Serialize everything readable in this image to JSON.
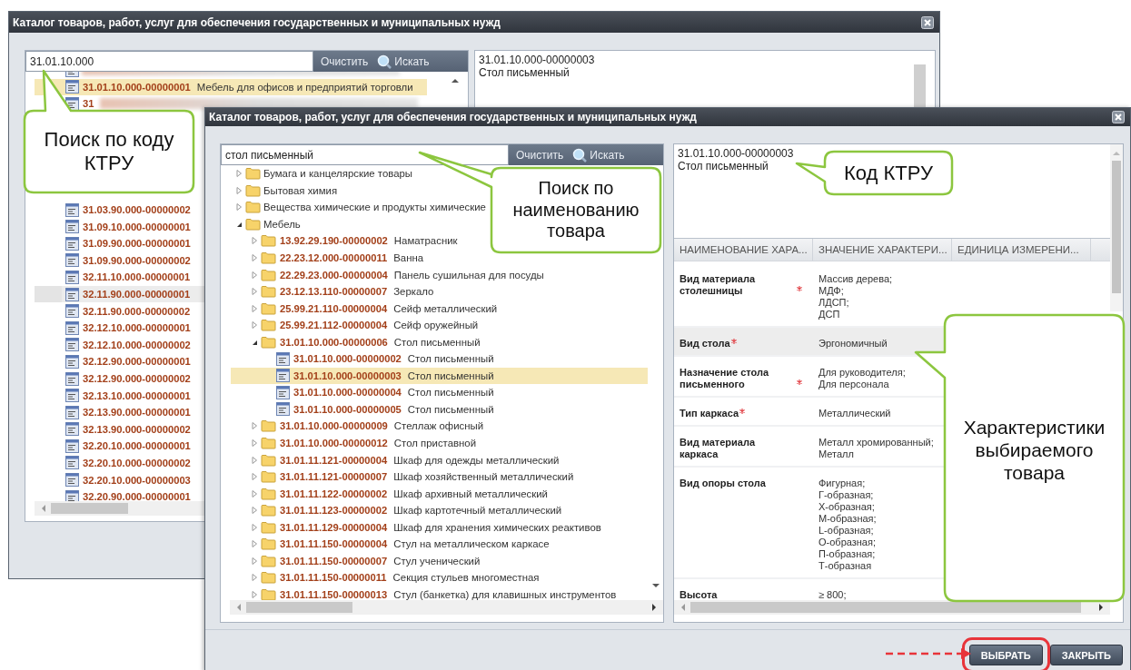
{
  "back_window": {
    "title": "Каталог товаров, работ, услуг для обеспечения государственных и муниципальных нужд",
    "search": {
      "value": "31.01.10.000",
      "clear_button": "Очистить",
      "search_button": "Искать"
    },
    "rows": [
      {
        "redacted": true,
        "selected": false,
        "hovered": false
      },
      {
        "code": "31.01.10.000-00000001",
        "name": "Мебель для офисов и предприятий торговли",
        "selected": true,
        "hovered": false
      },
      {
        "code": "31",
        "redacted": true,
        "selected": false,
        "hovered": false
      },
      {
        "code": "31.03.90.000-00000002",
        "selected": false,
        "hovered": false
      },
      {
        "code": "31.09.10.000-00000001",
        "selected": false,
        "hovered": false
      },
      {
        "code": "31.09.90.000-00000001",
        "selected": false,
        "hovered": false
      },
      {
        "code": "31.09.90.000-00000002",
        "selected": false,
        "hovered": false
      },
      {
        "code": "32.11.10.000-00000001",
        "selected": false,
        "hovered": false
      },
      {
        "code": "32.11.90.000-00000001",
        "selected": false,
        "hovered": true
      },
      {
        "code": "32.11.90.000-00000002",
        "selected": false,
        "hovered": false
      },
      {
        "code": "32.12.10.000-00000001",
        "selected": false,
        "hovered": false
      },
      {
        "code": "32.12.10.000-00000002",
        "selected": false,
        "hovered": false
      },
      {
        "code": "32.12.90.000-00000001",
        "selected": false,
        "hovered": false
      },
      {
        "code": "32.12.90.000-00000002",
        "selected": false,
        "hovered": false
      },
      {
        "code": "32.13.10.000-00000001",
        "selected": false,
        "hovered": false
      },
      {
        "code": "32.13.90.000-00000001",
        "selected": false,
        "hovered": false
      },
      {
        "code": "32.13.90.000-00000002",
        "selected": false,
        "hovered": false
      },
      {
        "code": "32.20.10.000-00000001",
        "selected": false,
        "hovered": false
      },
      {
        "code": "32.20.10.000-00000002",
        "selected": false,
        "hovered": false
      },
      {
        "code": "32.20.10.000-00000003",
        "selected": false,
        "hovered": false
      },
      {
        "code": "32.20.90.000-00000001",
        "selected": false,
        "hovered": false
      }
    ],
    "details": {
      "code": "31.01.10.000-00000003",
      "name": "Стол письменный"
    }
  },
  "front_window": {
    "title": "Каталог товаров, работ, услуг для обеспечения государственных и муниципальных нужд",
    "search": {
      "value": "стол письменный",
      "clear_button": "Очистить",
      "search_button": "Искать"
    },
    "tree": [
      {
        "kind": "folder",
        "name": "Бумага и канцелярские товары",
        "expanded": false,
        "selected": false
      },
      {
        "kind": "folder",
        "name": "Бытовая химия",
        "expanded": false,
        "selected": false
      },
      {
        "kind": "folder",
        "name": "Вещества химические и продукты химические",
        "expanded": false,
        "selected": false
      },
      {
        "kind": "folder",
        "name": "Мебель",
        "expanded": true,
        "selected": false,
        "children": [
          {
            "kind": "folder",
            "code": "13.92.29.190-00000002",
            "name": "Наматрасник",
            "expanded": false,
            "selected": false
          },
          {
            "kind": "folder",
            "code": "22.23.12.000-00000011",
            "name": "Ванна",
            "expanded": false,
            "selected": false
          },
          {
            "kind": "folder",
            "code": "22.29.23.000-00000004",
            "name": "Панель сушильная для посуды",
            "expanded": false,
            "selected": false
          },
          {
            "kind": "folder",
            "code": "23.12.13.110-00000007",
            "name": "Зеркало",
            "expanded": false,
            "selected": false
          },
          {
            "kind": "folder",
            "code": "25.99.21.110-00000004",
            "name": "Сейф металлический",
            "expanded": false,
            "selected": false
          },
          {
            "kind": "folder",
            "code": "25.99.21.112-00000004",
            "name": "Сейф оружейный",
            "expanded": false,
            "selected": false
          },
          {
            "kind": "folder",
            "code": "31.01.10.000-00000006",
            "name": "Стол письменный",
            "expanded": true,
            "selected": false,
            "children": [
              {
                "kind": "leaf",
                "code": "31.01.10.000-00000002",
                "name": "Стол письменный",
                "selected": false
              },
              {
                "kind": "leaf",
                "code": "31.01.10.000-00000003",
                "name": "Стол письменный",
                "selected": true
              },
              {
                "kind": "leaf",
                "code": "31.01.10.000-00000004",
                "name": "Стол письменный",
                "selected": false
              },
              {
                "kind": "leaf",
                "code": "31.01.10.000-00000005",
                "name": "Стол письменный",
                "selected": false
              }
            ]
          },
          {
            "kind": "folder",
            "code": "31.01.10.000-00000009",
            "name": "Стеллаж офисный",
            "expanded": false,
            "selected": false
          },
          {
            "kind": "folder",
            "code": "31.01.10.000-00000012",
            "name": "Стол приставной",
            "expanded": false,
            "selected": false
          },
          {
            "kind": "folder",
            "code": "31.01.11.121-00000004",
            "name": "Шкаф для одежды металлический",
            "expanded": false,
            "selected": false
          },
          {
            "kind": "folder",
            "code": "31.01.11.121-00000007",
            "name": "Шкаф хозяйственный металлический",
            "expanded": false,
            "selected": false
          },
          {
            "kind": "folder",
            "code": "31.01.11.122-00000002",
            "name": "Шкаф архивный металлический",
            "expanded": false,
            "selected": false
          },
          {
            "kind": "folder",
            "code": "31.01.11.123-00000002",
            "name": "Шкаф картотечный металлический",
            "expanded": false,
            "selected": false
          },
          {
            "kind": "folder",
            "code": "31.01.11.129-00000004",
            "name": "Шкаф для хранения химических реактивов",
            "expanded": false,
            "selected": false
          },
          {
            "kind": "folder",
            "code": "31.01.11.150-00000004",
            "name": "Стул на металлическом каркасе",
            "expanded": false,
            "selected": false
          },
          {
            "kind": "folder",
            "code": "31.01.11.150-00000007",
            "name": "Стул ученический",
            "expanded": false,
            "selected": false
          },
          {
            "kind": "folder",
            "code": "31.01.11.150-00000011",
            "name": "Секция стульев многоместная",
            "expanded": false,
            "selected": false
          },
          {
            "kind": "folder",
            "code": "31.01.11.150-00000013",
            "name": "Стул (банкетка) для клавишных инструментов",
            "expanded": false,
            "selected": false
          }
        ]
      }
    ],
    "details": {
      "code": "31.01.10.000-00000003",
      "name": "Стол письменный"
    },
    "table": {
      "columns": [
        "НАИМЕНОВАНИЕ ХАРА...",
        "ЗНАЧЕНИЕ ХАРАКТЕРИ...",
        "ЕДИНИЦА ИЗМЕРЕНИ..."
      ],
      "rows": [
        {
          "name": "Вид материала столешницы",
          "required": true,
          "highlighted": false,
          "values": [
            "Массив дерева;",
            "МДФ;",
            "ЛДСП;",
            "ДСП"
          ]
        },
        {
          "name": "Вид стола",
          "required": true,
          "highlighted": true,
          "values": [
            "Эргономичный"
          ]
        },
        {
          "name": "Назначение стола письменного",
          "required": true,
          "highlighted": false,
          "values": [
            "Для руководителя;",
            "Для персонала"
          ]
        },
        {
          "name": "Тип каркаса",
          "required": true,
          "highlighted": false,
          "values": [
            "Металлический"
          ]
        },
        {
          "name": "Вид материала каркаса",
          "required": false,
          "highlighted": false,
          "values": [
            "Металл хромированный;",
            "Металл"
          ]
        },
        {
          "name": "Вид опоры стола",
          "required": false,
          "highlighted": false,
          "values": [
            "Фигурная;",
            "Г-образная;",
            "Х-образная;",
            "М-образная;",
            "L-образная;",
            "О-образная;",
            "П-образная;",
            "Т-образная"
          ]
        },
        {
          "name": "Высота",
          "required": false,
          "highlighted": false,
          "values": [
            "≥ 800;"
          ]
        }
      ]
    },
    "buttons": [
      {
        "label": "ВЫБРАТЬ",
        "highlighted": true
      },
      {
        "label": "ЗАКРЫТЬ",
        "highlighted": false
      }
    ]
  },
  "callouts": [
    {
      "text": "Поиск по коду\nКТРУ"
    },
    {
      "text": "Поиск по\nнаименованию\nтовара"
    },
    {
      "text": "Код КТРУ"
    },
    {
      "text": "Характеристики\nвыбираемого\nтовара"
    }
  ]
}
